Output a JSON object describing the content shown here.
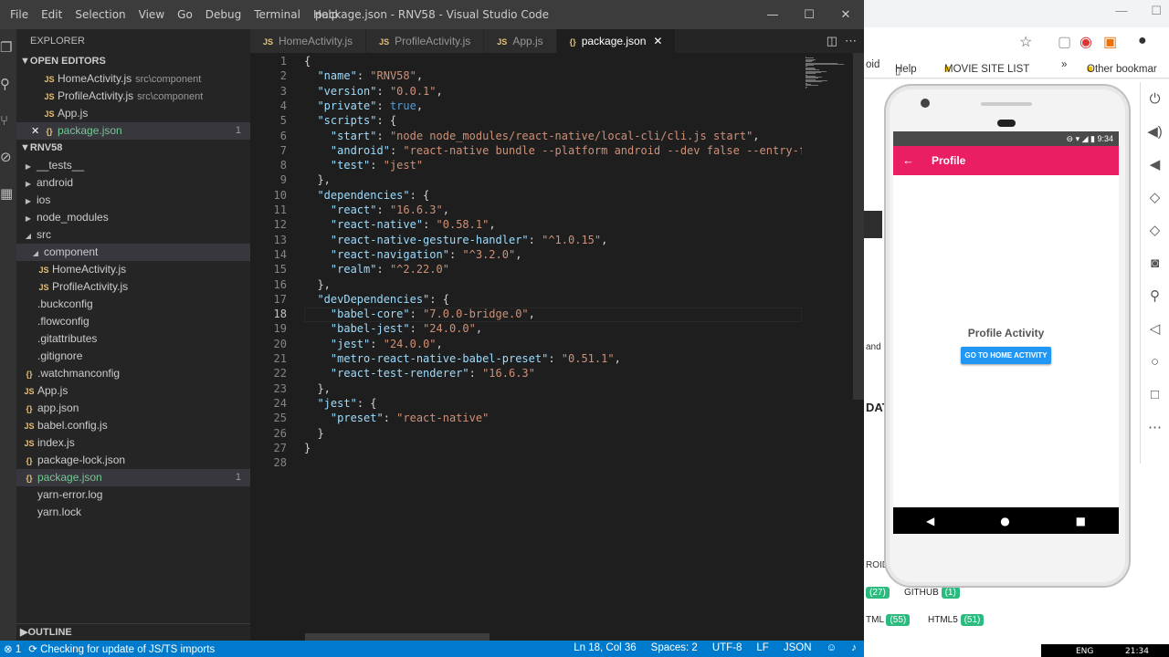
{
  "window": {
    "title": "package.json - RNV58 - Visual Studio Code",
    "menu": [
      "File",
      "Edit",
      "Selection",
      "View",
      "Go",
      "Debug",
      "Terminal",
      "Help"
    ],
    "controls": [
      "—",
      "☐",
      "✕"
    ]
  },
  "sidebar": {
    "header": "EXPLORER",
    "open_editors_label": "OPEN EDITORS",
    "open_editors": [
      {
        "name": "HomeActivity.js",
        "desc": "src\\component",
        "icon": "JS"
      },
      {
        "name": "ProfileActivity.js",
        "desc": "src\\component",
        "icon": "JS"
      },
      {
        "name": "App.js",
        "desc": "",
        "icon": "JS"
      },
      {
        "name": "package.json",
        "desc": "",
        "icon": "{}",
        "badge": "1"
      }
    ],
    "project_label": "RNV58",
    "tree": [
      {
        "name": "__tests__",
        "type": "folder"
      },
      {
        "name": "android",
        "type": "folder"
      },
      {
        "name": "ios",
        "type": "folder"
      },
      {
        "name": "node_modules",
        "type": "folder"
      },
      {
        "name": "src",
        "type": "folder-open"
      },
      {
        "name": "component",
        "type": "folder-open"
      },
      {
        "name": "HomeActivity.js",
        "type": "js"
      },
      {
        "name": "ProfileActivity.js",
        "type": "js"
      },
      {
        "name": ".buckconfig",
        "type": "file"
      },
      {
        "name": ".flowconfig",
        "type": "file"
      },
      {
        "name": ".gitattributes",
        "type": "file"
      },
      {
        "name": ".gitignore",
        "type": "file"
      },
      {
        "name": ".watchmanconfig",
        "type": "json"
      },
      {
        "name": "App.js",
        "type": "js"
      },
      {
        "name": "app.json",
        "type": "json"
      },
      {
        "name": "babel.config.js",
        "type": "js"
      },
      {
        "name": "index.js",
        "type": "js"
      },
      {
        "name": "package-lock.json",
        "type": "json"
      },
      {
        "name": "package.json",
        "type": "json",
        "badge": "1"
      },
      {
        "name": "yarn-error.log",
        "type": "file"
      },
      {
        "name": "yarn.lock",
        "type": "file"
      }
    ],
    "outline_label": "OUTLINE"
  },
  "tabs": [
    {
      "label": "HomeActivity.js",
      "icon": "JS"
    },
    {
      "label": "ProfileActivity.js",
      "icon": "JS"
    },
    {
      "label": "App.js",
      "icon": "JS"
    },
    {
      "label": "package.json",
      "icon": "{}",
      "close": "✕"
    }
  ],
  "editor": {
    "current_line": 18,
    "lines": [
      "{",
      "  \"name\": \"RNV58\",",
      "  \"version\": \"0.0.1\",",
      "  \"private\": true,",
      "  \"scripts\": {",
      "    \"start\": \"node node_modules/react-native/local-cli/cli.js start\",",
      "    \"android\": \"react-native bundle --platform android --dev false --entry-file inc",
      "    \"test\": \"jest\"",
      "  },",
      "  \"dependencies\": {",
      "    \"react\": \"16.6.3\",",
      "    \"react-native\": \"0.58.1\",",
      "    \"react-native-gesture-handler\": \"^1.0.15\",",
      "    \"react-navigation\": \"^3.2.0\",",
      "    \"realm\": \"^2.22.0\"",
      "  },",
      "  \"devDependencies\": {",
      "    \"babel-core\": \"7.0.0-bridge.0\",",
      "    \"babel-jest\": \"24.0.0\",",
      "    \"jest\": \"24.0.0\",",
      "    \"metro-react-native-babel-preset\": \"0.51.1\",",
      "    \"react-test-renderer\": \"16.6.3\"",
      "  },",
      "  \"jest\": {",
      "    \"preset\": \"react-native\"",
      "  }",
      "}",
      ""
    ]
  },
  "status": {
    "errors": "⊗ 1",
    "checking": "Checking for update of JS/TS imports",
    "position": "Ln 18, Col 36",
    "spaces": "Spaces: 2",
    "encoding": "UTF-8",
    "eol": "LF",
    "language": "JSON"
  },
  "browser": {
    "bookmarks": [
      "oid",
      "Help",
      "MOVIE SITE LIST",
      "»",
      "Other bookmar"
    ],
    "page_fragments": {
      "and": "and",
      "dat": "DAT",
      "roid": "ROID"
    },
    "pills": [
      {
        "label": "",
        "count": "(27)"
      },
      {
        "label": "GITHUB",
        "count": "(1)"
      },
      {
        "label": "TML",
        "count": "(55)"
      },
      {
        "label": "HTML5",
        "count": "(51)"
      }
    ]
  },
  "phone": {
    "time": "9:34",
    "appbar_title": "Profile",
    "back_icon": "←",
    "page_title": "Profile Activity",
    "button_label": "GO TO HOME ACTIVITY",
    "nav": [
      "◀",
      "●",
      "■"
    ]
  },
  "taskbar": {
    "lang": "ENG",
    "time": "21:34"
  }
}
